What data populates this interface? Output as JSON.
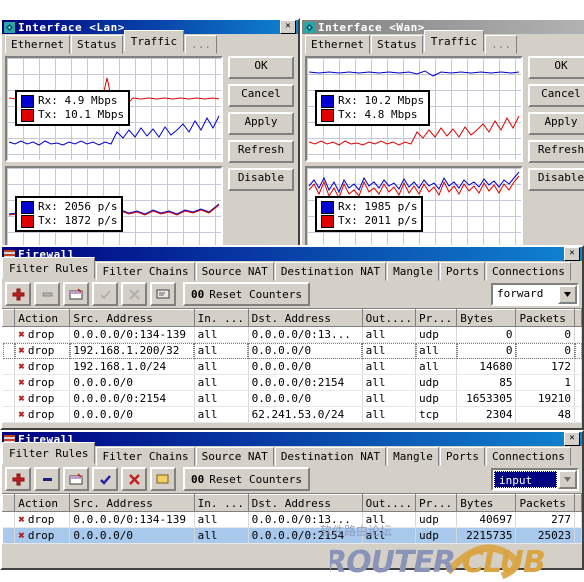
{
  "windows": {
    "lan": {
      "title": "Interface <Lan>",
      "icon": "interface-icon",
      "close_label": "✕",
      "tabs": [
        {
          "label": "Ethernet",
          "active": false
        },
        {
          "label": "Status",
          "active": false
        },
        {
          "label": "Traffic",
          "active": true
        },
        {
          "label": "...",
          "active": false
        }
      ],
      "buttons": [
        "OK",
        "Cancel",
        "Apply",
        "Refresh",
        "Disable"
      ],
      "graph_rate": {
        "rx_label": "Rx:",
        "rx_value": "4.9 Mbps",
        "tx_label": "Tx:",
        "tx_value": "10.1 Mbps"
      },
      "graph_packets": {
        "rx_label": "Rx:",
        "rx_value": "2056 p/s",
        "tx_label": "Tx:",
        "tx_value": "1872 p/s"
      }
    },
    "wan": {
      "title": "Interface <Wan>",
      "icon": "interface-icon",
      "close_label": "✕",
      "tabs": [
        {
          "label": "Ethernet",
          "active": false
        },
        {
          "label": "Status",
          "active": false
        },
        {
          "label": "Traffic",
          "active": true
        },
        {
          "label": "...",
          "active": false
        }
      ],
      "buttons": [
        "OK",
        "Cancel",
        "Apply",
        "Refresh",
        "Disable"
      ],
      "graph_rate": {
        "rx_label": "Rx:",
        "rx_value": "10.2 Mbps",
        "tx_label": "Tx:",
        "tx_value": "4.8 Mbps"
      },
      "graph_packets": {
        "rx_label": "Rx:",
        "rx_value": "1985 p/s",
        "tx_label": "Tx:",
        "tx_value": "2011 p/s"
      }
    },
    "firewall_forward": {
      "title": "Firewall",
      "icon": "firewall-icon",
      "close_label": "✕",
      "tabs": [
        {
          "label": "Filter Rules",
          "active": true
        },
        {
          "label": "Filter Chains",
          "active": false
        },
        {
          "label": "Source NAT",
          "active": false
        },
        {
          "label": "Destination NAT",
          "active": false
        },
        {
          "label": "Mangle",
          "active": false
        },
        {
          "label": "Ports",
          "active": false
        },
        {
          "label": "Connections",
          "active": false
        }
      ],
      "toolbar": {
        "add": "+",
        "remove": "–",
        "copy": "copy-icon",
        "enable": "✔",
        "disable": "✖",
        "comment": "comment-icon",
        "counter_badge": "00",
        "reset_label": "Reset Counters",
        "disabled_buttons": [
          "enable",
          "disable"
        ]
      },
      "chain": {
        "value": "forward",
        "selected": false
      },
      "columns": [
        "Action",
        "Src. Address",
        "In. ...",
        "Dst. Address",
        "Out....",
        "Pr...",
        "Bytes",
        "Packets"
      ],
      "rows": [
        {
          "action": "drop",
          "src": "0.0.0.0/0:134-139",
          "in": "all",
          "dst": "0.0.0.0/0:13...",
          "out": "all",
          "proto": "udp",
          "bytes": "0",
          "packets": "0",
          "state": "normal"
        },
        {
          "action": "drop",
          "src": "192.168.1.200/32",
          "in": "all",
          "dst": "0.0.0.0/0",
          "out": "all",
          "proto": "all",
          "bytes": "0",
          "packets": "0",
          "state": "focus"
        },
        {
          "action": "drop",
          "src": "192.168.1.0/24",
          "in": "all",
          "dst": "0.0.0.0/0",
          "out": "all",
          "proto": "all",
          "bytes": "14680",
          "packets": "172",
          "state": "normal"
        },
        {
          "action": "drop",
          "src": "0.0.0.0/0",
          "in": "all",
          "dst": "0.0.0.0/0:2154",
          "out": "all",
          "proto": "udp",
          "bytes": "85",
          "packets": "1",
          "state": "normal"
        },
        {
          "action": "drop",
          "src": "0.0.0.0/0:2154",
          "in": "all",
          "dst": "0.0.0.0/0",
          "out": "all",
          "proto": "udp",
          "bytes": "1653305",
          "packets": "19210",
          "state": "normal"
        },
        {
          "action": "drop",
          "src": "0.0.0.0/0",
          "in": "all",
          "dst": "62.241.53.0/24",
          "out": "all",
          "proto": "tcp",
          "bytes": "2304",
          "packets": "48",
          "state": "normal"
        }
      ]
    },
    "firewall_input": {
      "title": "Firewall",
      "icon": "firewall-icon",
      "close_label": "✕",
      "tabs": [
        {
          "label": "Filter Rules",
          "active": true
        },
        {
          "label": "Filter Chains",
          "active": false
        },
        {
          "label": "Source NAT",
          "active": false
        },
        {
          "label": "Destination NAT",
          "active": false
        },
        {
          "label": "Mangle",
          "active": false
        },
        {
          "label": "Ports",
          "active": false
        },
        {
          "label": "Connections",
          "active": false
        }
      ],
      "toolbar": {
        "add": "+",
        "remove": "–",
        "copy": "copy-icon",
        "enable": "✔",
        "disable": "✖",
        "comment": "comment-icon",
        "counter_badge": "00",
        "reset_label": "Reset Counters",
        "disabled_buttons": []
      },
      "chain": {
        "value": "input",
        "selected": true
      },
      "columns": [
        "Action",
        "Src. Address",
        "In. ...",
        "Dst. Address",
        "Out....",
        "Pr...",
        "Bytes",
        "Packets"
      ],
      "rows": [
        {
          "action": "drop",
          "src": "0.0.0.0/0:134-139",
          "in": "all",
          "dst": "0.0.0.0/0:13...",
          "out": "all",
          "proto": "udp",
          "bytes": "40697",
          "packets": "277",
          "state": "normal"
        },
        {
          "action": "drop",
          "src": "0.0.0.0/0",
          "in": "all",
          "dst": "0.0.0.0/0:2154",
          "out": "all",
          "proto": "udp",
          "bytes": "2215735",
          "packets": "25023",
          "state": "selected"
        }
      ]
    }
  },
  "watermark": {
    "router": "ROUTER",
    "club": "CLUB",
    "cn": "软件路由论坛",
    "router_color": "#8a93b8",
    "club_color": "#d9a441"
  },
  "colors": {
    "title_active": "#000080",
    "title_inactive": "#808080",
    "face": "#d4d0c8",
    "rx": "#0000d0",
    "tx": "#e00000",
    "selection": "#a8c8ec"
  }
}
